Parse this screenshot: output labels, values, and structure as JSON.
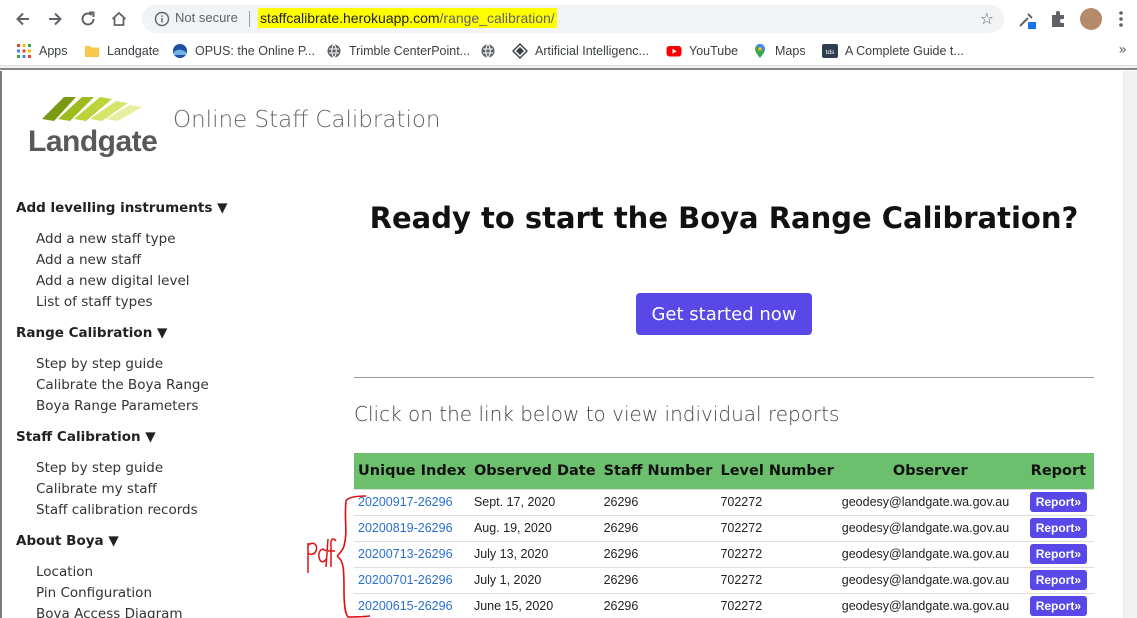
{
  "browser": {
    "security_label": "Not secure",
    "url_host": "staffcalibrate.herokuapp.com",
    "url_path": "/range_calibration/"
  },
  "bookmarks": [
    {
      "label": "Apps",
      "icon": "apps-grid-icon"
    },
    {
      "label": "Landgate",
      "icon": "folder-icon"
    },
    {
      "label": "OPUS: the Online P...",
      "icon": "noaa-icon"
    },
    {
      "label": "Trimble CenterPoint...",
      "icon": "globe-icon"
    },
    {
      "label": "",
      "icon": "globe-icon"
    },
    {
      "label": "Artificial Intelligenc...",
      "icon": "diamond-icon"
    },
    {
      "label": "YouTube",
      "icon": "youtube-icon"
    },
    {
      "label": "Maps",
      "icon": "maps-pin-icon"
    },
    {
      "label": "A Complete Guide t...",
      "icon": "tds-icon"
    }
  ],
  "site": {
    "logo_text": "Landgate",
    "title": "Online Staff Calibration"
  },
  "sidebar": {
    "sections": [
      {
        "heading": "Add levelling instruments ▼",
        "items": [
          "Add a new staff type",
          "Add a new staff",
          "Add a new digital level",
          "List of staff types"
        ]
      },
      {
        "heading": "Range Calibration ▼",
        "items": [
          "Step by step guide",
          "Calibrate the Boya Range",
          "Boya Range Parameters"
        ]
      },
      {
        "heading": "Staff Calibration ▼",
        "items": [
          "Step by step guide",
          "Calibrate my staff",
          "Staff calibration records"
        ]
      },
      {
        "heading": "About Boya ▼",
        "items": [
          "Location",
          "Pin Configuration",
          "Boya Access Diagram"
        ]
      }
    ]
  },
  "main": {
    "hero_heading": "Ready to start the Boya Range Calibration?",
    "cta_label": "Get started now",
    "subheading": "Click on the link below to view individual reports"
  },
  "table": {
    "headers": [
      "Unique Index",
      "Observed Date",
      "Staff Number",
      "Level Number",
      "Observer",
      "Report"
    ],
    "rows": [
      {
        "index": "20200917-26296",
        "date": "Sept. 17, 2020",
        "staff": "26296",
        "level": "702272",
        "observer": "geodesy@landgate.wa.gov.au",
        "report": "Report»"
      },
      {
        "index": "20200819-26296",
        "date": "Aug. 19, 2020",
        "staff": "26296",
        "level": "702272",
        "observer": "geodesy@landgate.wa.gov.au",
        "report": "Report»"
      },
      {
        "index": "20200713-26296",
        "date": "July 13, 2020",
        "staff": "26296",
        "level": "702272",
        "observer": "geodesy@landgate.wa.gov.au",
        "report": "Report»"
      },
      {
        "index": "20200701-26296",
        "date": "July 1, 2020",
        "staff": "26296",
        "level": "702272",
        "observer": "geodesy@landgate.wa.gov.au",
        "report": "Report»"
      },
      {
        "index": "20200615-26296",
        "date": "June 15, 2020",
        "staff": "26296",
        "level": "702272",
        "observer": "geodesy@landgate.wa.gov.au",
        "report": "Report»"
      }
    ]
  },
  "annotation": {
    "text": "pdf",
    "color": "#e01010"
  },
  "colors": {
    "accent": "#5848e8",
    "table_header": "#6cbf6c",
    "link": "#2a6fd0",
    "url_highlight": "#ffff00"
  }
}
